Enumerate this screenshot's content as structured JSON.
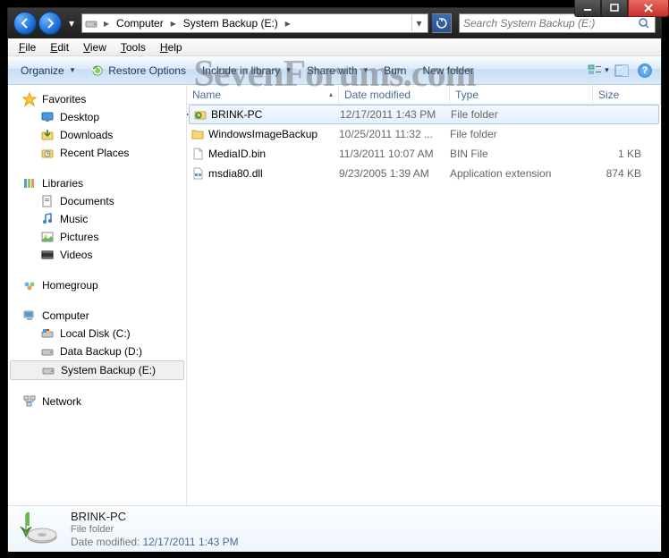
{
  "titlebar": {
    "minimize": "_",
    "maximize": "□",
    "close": "×"
  },
  "address": {
    "segments": [
      "Computer",
      "System Backup (E:)"
    ],
    "search_placeholder": "Search System Backup (E:)"
  },
  "menubar": {
    "items": [
      {
        "label": "File",
        "key": "F"
      },
      {
        "label": "Edit",
        "key": "E"
      },
      {
        "label": "View",
        "key": "V"
      },
      {
        "label": "Tools",
        "key": "T"
      },
      {
        "label": "Help",
        "key": "H"
      }
    ]
  },
  "toolbar": {
    "organize": "Organize",
    "restore": "Restore Options",
    "include": "Include in library",
    "share": "Share with",
    "burn": "Burn",
    "newfolder": "New folder"
  },
  "sidebar": {
    "favorites": {
      "label": "Favorites",
      "items": [
        "Desktop",
        "Downloads",
        "Recent Places"
      ]
    },
    "libraries": {
      "label": "Libraries",
      "items": [
        "Documents",
        "Music",
        "Pictures",
        "Videos"
      ]
    },
    "homegroup": {
      "label": "Homegroup"
    },
    "computer": {
      "label": "Computer",
      "items": [
        "Local Disk (C:)",
        "Data Backup (D:)",
        "System Backup (E:)"
      ]
    },
    "network": {
      "label": "Network"
    }
  },
  "columns": {
    "name": "Name",
    "date": "Date modified",
    "type": "Type",
    "size": "Size"
  },
  "files": [
    {
      "name": "BRINK-PC",
      "date": "12/17/2011 1:43 PM",
      "type": "File folder",
      "size": "",
      "icon": "backup-folder",
      "selected": true
    },
    {
      "name": "WindowsImageBackup",
      "date": "10/25/2011 11:32 ...",
      "type": "File folder",
      "size": "",
      "icon": "folder",
      "selected": false
    },
    {
      "name": "MediaID.bin",
      "date": "11/3/2011 10:07 AM",
      "type": "BIN File",
      "size": "1 KB",
      "icon": "file",
      "selected": false
    },
    {
      "name": "msdia80.dll",
      "date": "9/23/2005 1:39 AM",
      "type": "Application extension",
      "size": "874 KB",
      "icon": "dll",
      "selected": false
    }
  ],
  "details": {
    "title": "BRINK-PC",
    "subtitle": "File folder",
    "meta_label": "Date modified:",
    "meta_value": "12/17/2011 1:43 PM"
  },
  "watermark": "SevenForums.com"
}
